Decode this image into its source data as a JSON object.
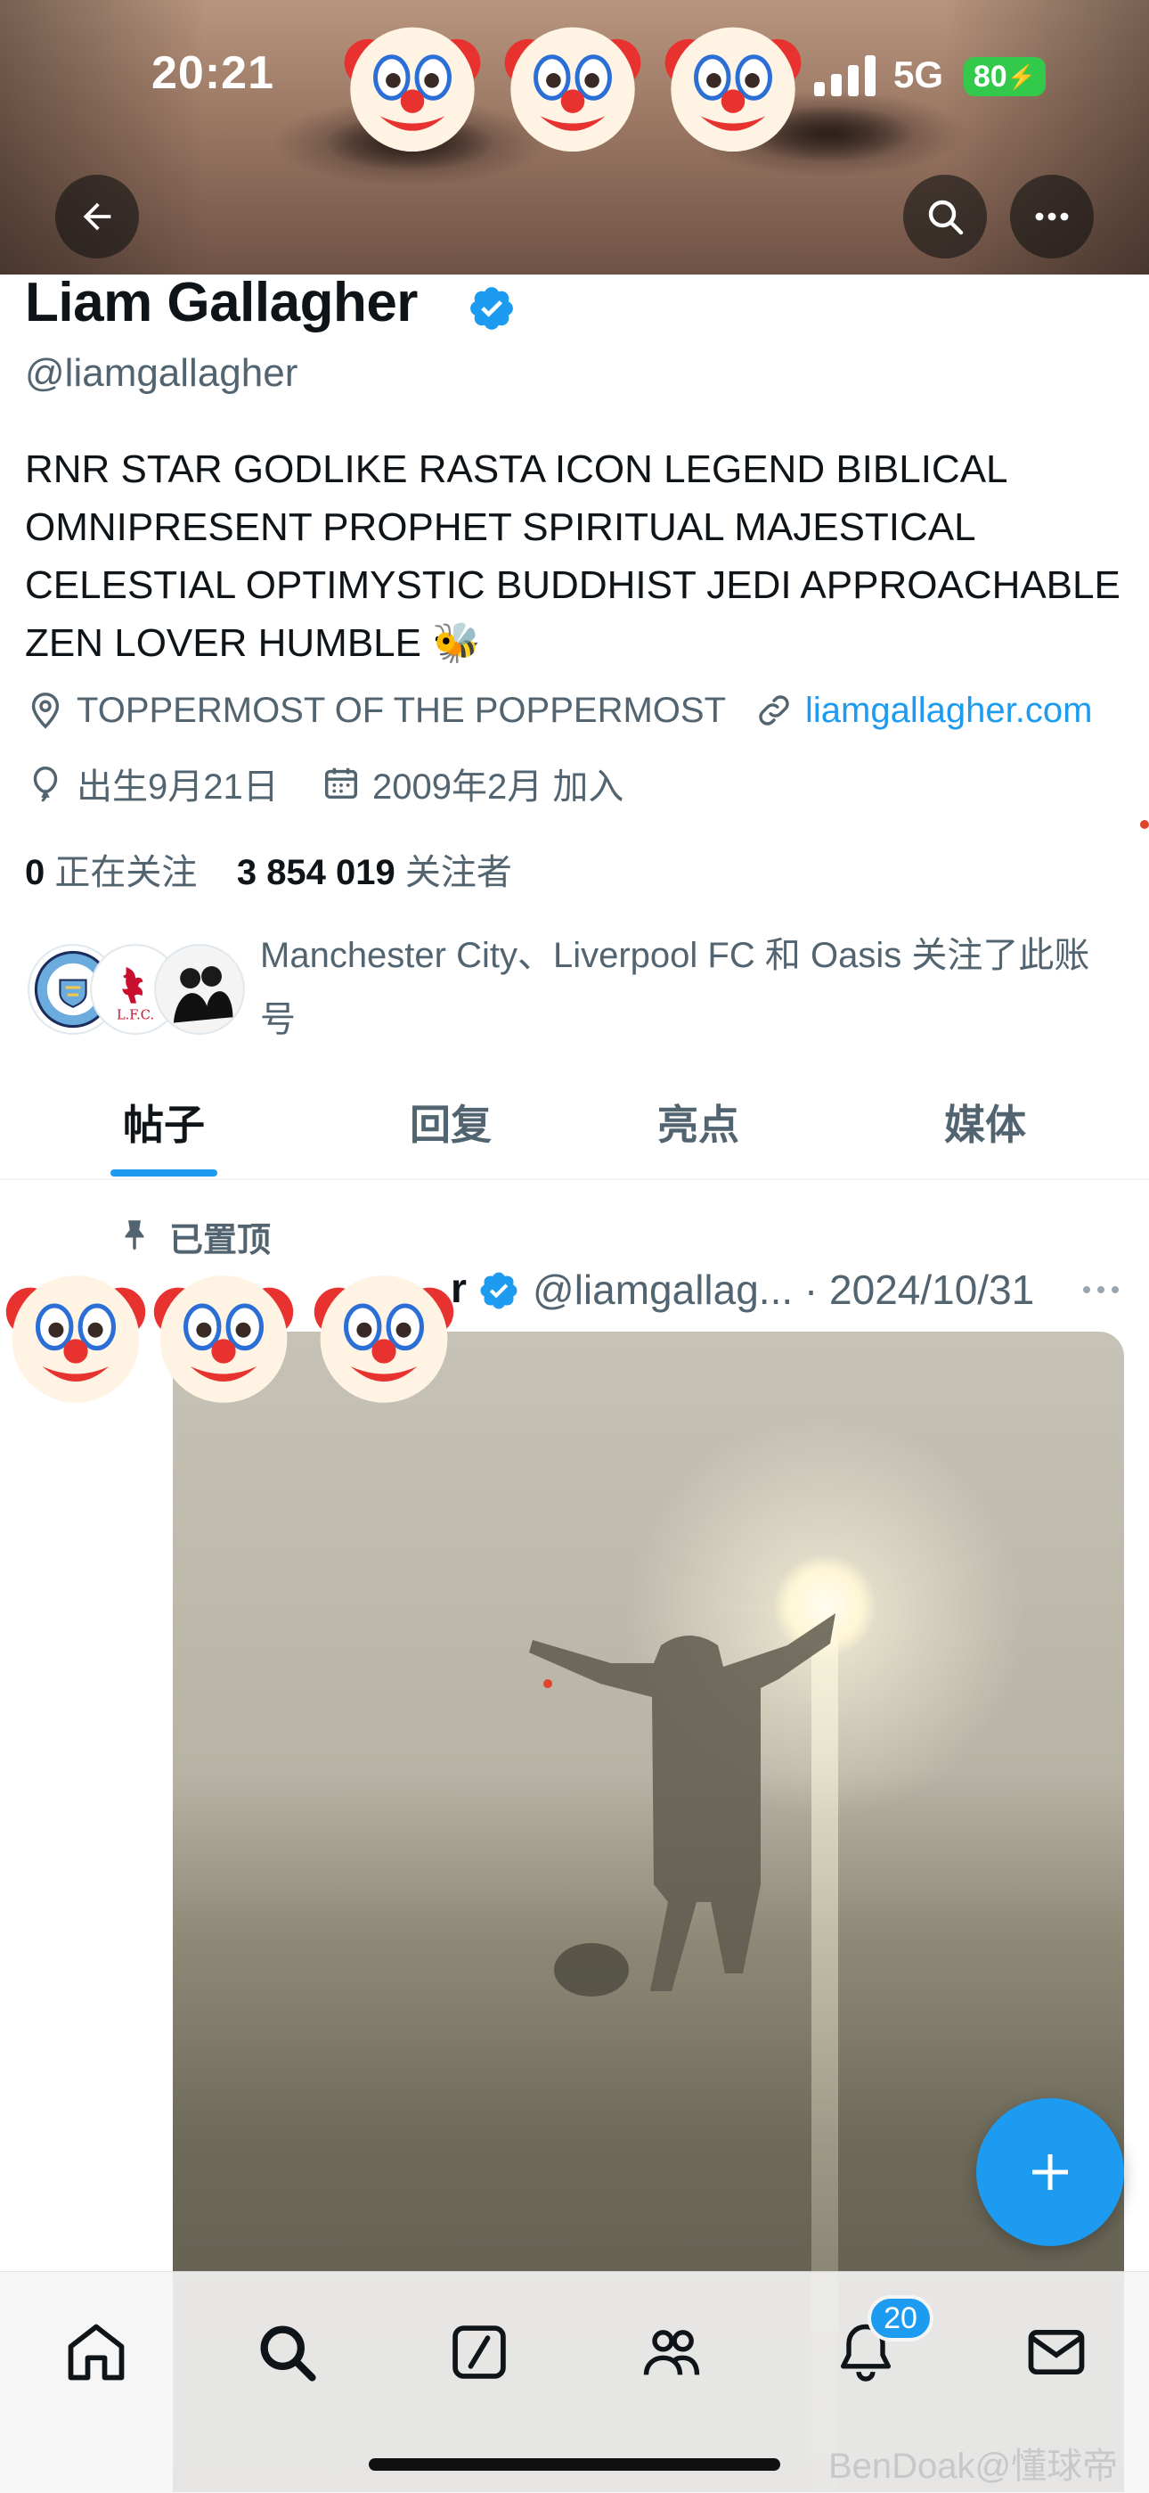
{
  "status_bar": {
    "time": "20:21",
    "network": "5G",
    "battery": "80"
  },
  "profile": {
    "name": "Liam Gallagher",
    "handle": "@liamgallagher",
    "bio": "RNR STAR GODLIKE RASTA ICON LEGEND BIBLICAL OMNIPRESENT PROPHET SPIRITUAL MAJESTICAL CELESTIAL OPTIMYSTIC BUDDHIST JEDI APPROACHABLE ZEN LOVER HUMBLE 🐝",
    "location": "TOPPERMOST OF THE POPPERMOST",
    "website": "liamgallagher.com",
    "birthday": "出生9月21日",
    "joined": "2009年2月 加入",
    "following_count": "0",
    "following_label": "正在关注",
    "followers_count": "3 854 019",
    "followers_label": "关注者",
    "followed_by": "Manchester City、Liverpool FC 和 Oasis 关注了此账号"
  },
  "tabs": [
    {
      "label": "帖子",
      "active": true
    },
    {
      "label": "回复",
      "active": false
    },
    {
      "label": "亮点",
      "active": false
    },
    {
      "label": "媒体",
      "active": false
    }
  ],
  "post": {
    "pinned_label": "已置顶",
    "author_partial": "r",
    "handle_and_date": "@liamgallag... · 2024/10/31"
  },
  "nav": {
    "notifications_badge": "20",
    "icons": [
      "home-icon",
      "search-icon",
      "compose-icon",
      "communities-icon",
      "notifications-icon",
      "messages-icon"
    ]
  },
  "watermark": "BenDoak@懂球帝",
  "colors": {
    "accent": "#1d9bf0",
    "text": "#0f1419",
    "secondary": "#536471",
    "battery": "#33c94b"
  }
}
